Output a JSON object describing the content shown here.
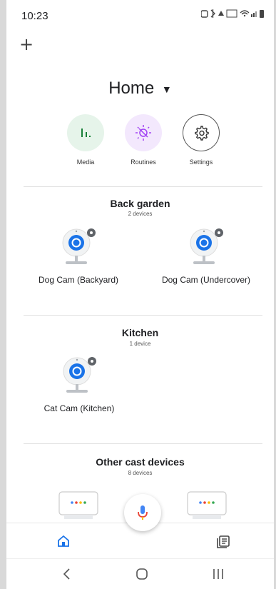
{
  "status_bar": {
    "time": "10:23"
  },
  "header": {
    "add_label": "+",
    "title": "Home"
  },
  "shortcuts": [
    {
      "label": "Media",
      "icon": "media-icon",
      "color": "#e6f4ea"
    },
    {
      "label": "Routines",
      "icon": "routines-icon",
      "color": "#f3e8fd"
    },
    {
      "label": "Settings",
      "icon": "gear-icon",
      "color": "#ffffff"
    }
  ],
  "rooms": [
    {
      "name": "Back garden",
      "count": "2 devices",
      "devices": [
        {
          "label": "Dog Cam (Backyard)"
        },
        {
          "label": "Dog Cam (Undercover)"
        }
      ]
    },
    {
      "name": "Kitchen",
      "count": "1 device",
      "devices": [
        {
          "label": "Cat Cam (Kitchen)"
        }
      ]
    },
    {
      "name": "Other cast devices",
      "count": "8 devices",
      "devices": []
    }
  ],
  "colors": {
    "accent": "#1a73e8",
    "media_green": "#188038",
    "routines_purple": "#a142f4"
  }
}
